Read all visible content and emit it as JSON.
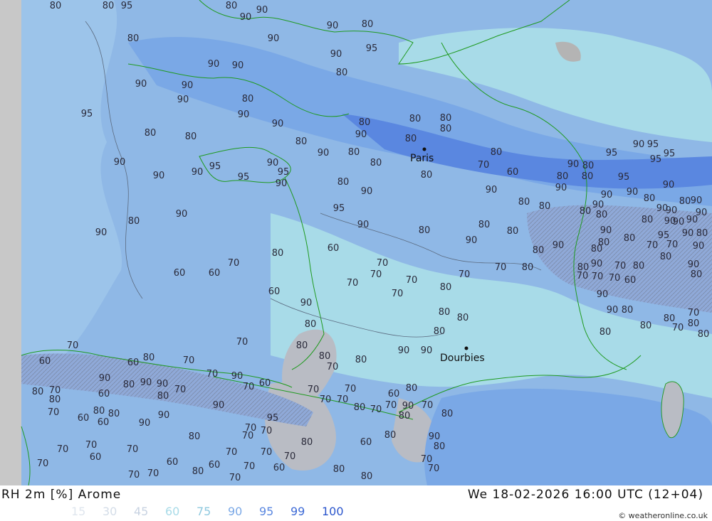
{
  "map": {
    "title": "RH 2m [%] Arome",
    "datetime": "We 18-02-2026 16:00 UTC (12+04)",
    "credit": "© weatheronline.co.uk",
    "legend": [
      {
        "label": "15",
        "color": "#dfe6ee"
      },
      {
        "label": "30",
        "color": "#d4dde8"
      },
      {
        "label": "45",
        "color": "#c8d3e2"
      },
      {
        "label": "60",
        "color": "#a8dbe8"
      },
      {
        "label": "75",
        "color": "#8fc9df"
      },
      {
        "label": "90",
        "color": "#7aa8e6"
      },
      {
        "label": "95",
        "color": "#5a87e0"
      },
      {
        "label": "99",
        "color": "#3d6ad6"
      },
      {
        "label": "100",
        "color": "#2a55cc"
      }
    ],
    "cities": [
      {
        "name": "Paris"
      },
      {
        "name": "Dourbies"
      }
    ],
    "contour_labels": [
      "80",
      "80",
      "95",
      "80",
      "90",
      "90",
      "90",
      "80",
      "80",
      "90",
      "90",
      "95",
      "90",
      "90",
      "80",
      "90",
      "90",
      "90",
      "80",
      "90",
      "95",
      "80",
      "80",
      "90",
      "80",
      "90",
      "80",
      "80",
      "80",
      "90",
      "90",
      "90",
      "90",
      "95",
      "95",
      "95",
      "90",
      "90",
      "95",
      "90",
      "80",
      "90",
      "90",
      "80",
      "90",
      "80",
      "80",
      "80",
      "80",
      "80",
      "90",
      "80",
      "90",
      "80",
      "80",
      "80",
      "80",
      "80",
      "60",
      "70",
      "60",
      "60",
      "70",
      "60",
      "70",
      "70",
      "70",
      "70",
      "80",
      "70",
      "90",
      "80",
      "70",
      "80",
      "80",
      "70",
      "80",
      "90",
      "90",
      "80",
      "80",
      "80",
      "70",
      "80",
      "80",
      "90",
      "70",
      "60",
      "60",
      "80",
      "70",
      "90",
      "80",
      "90",
      "90",
      "70",
      "80",
      "70",
      "90",
      "70",
      "60",
      "70",
      "70",
      "70",
      "70",
      "80",
      "70",
      "60",
      "70",
      "80",
      "90",
      "70",
      "80",
      "80",
      "80",
      "90",
      "80",
      "60",
      "80",
      "80",
      "70",
      "80",
      "60",
      "70",
      "60",
      "80",
      "80",
      "60",
      "90",
      "90",
      "95",
      "90",
      "80",
      "70",
      "70",
      "70",
      "70",
      "70",
      "70",
      "60",
      "70",
      "70",
      "60",
      "60",
      "70",
      "60",
      "70",
      "70",
      "70",
      "70",
      "80",
      "70",
      "80",
      "80",
      "70",
      "70",
      "80",
      "60",
      "70",
      "80",
      "90",
      "90",
      "80",
      "80",
      "95",
      "95",
      "90",
      "95",
      "95",
      "90",
      "95",
      "90",
      "90",
      "80",
      "80",
      "90",
      "80",
      "80",
      "90",
      "90",
      "90",
      "90",
      "80",
      "90",
      "90",
      "95",
      "90",
      "90",
      "80",
      "90",
      "80",
      "80",
      "80",
      "70",
      "70",
      "90",
      "80",
      "80",
      "70",
      "90",
      "80",
      "70",
      "70",
      "70",
      "60",
      "90",
      "80",
      "90",
      "90",
      "80",
      "80",
      "80",
      "70",
      "80",
      "70",
      "80",
      "80"
    ]
  }
}
